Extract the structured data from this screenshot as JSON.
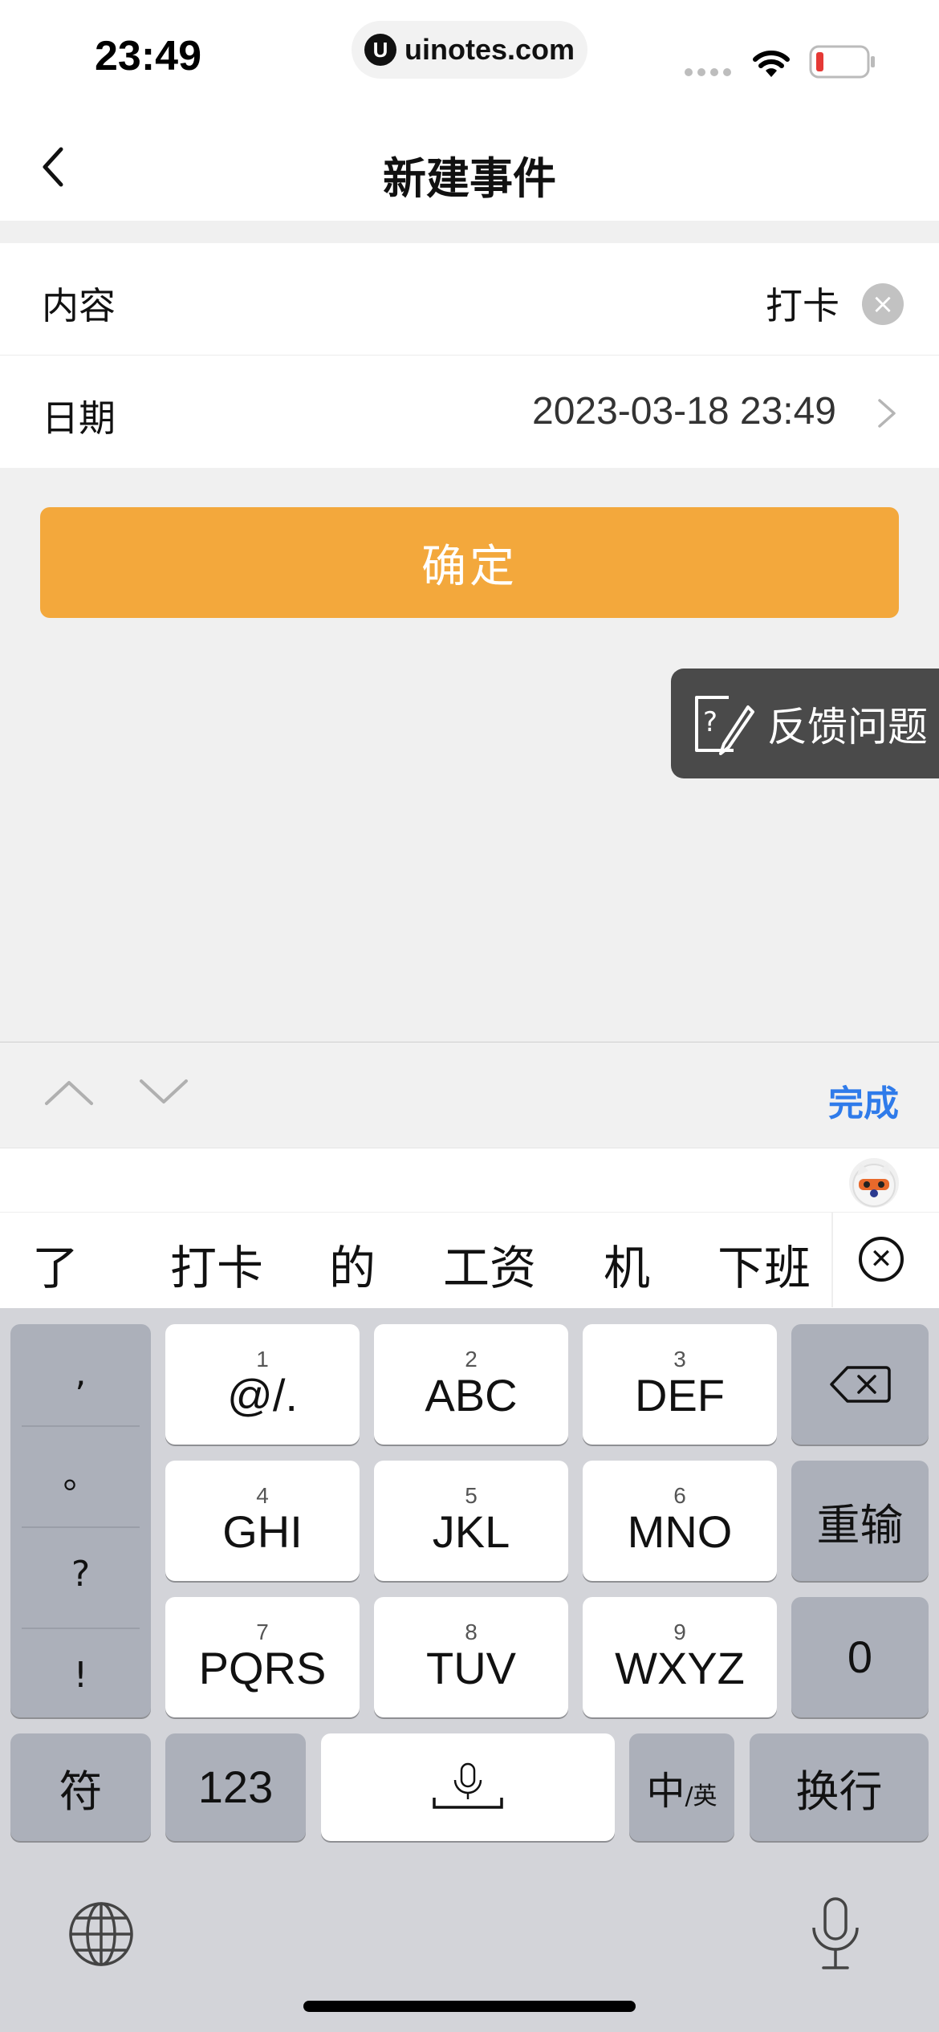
{
  "status_bar": {
    "time": "23:49",
    "url": "uinotes.com",
    "url_logo": "U"
  },
  "nav": {
    "title": "新建事件"
  },
  "form": {
    "content_label": "内容",
    "content_value": "打卡",
    "date_label": "日期",
    "date_value": "2023-03-18 23:49"
  },
  "confirm_label": "确定",
  "feedback_label": "反馈问题",
  "accessory": {
    "done_label": "完成"
  },
  "candidates": [
    "了",
    "打卡",
    "的",
    "工资",
    "机",
    "下班"
  ],
  "keyboard": {
    "punct": [
      ",",
      "。",
      "?",
      "!"
    ],
    "keys": [
      {
        "num": "1",
        "letters": "@/."
      },
      {
        "num": "2",
        "letters": "ABC"
      },
      {
        "num": "3",
        "letters": "DEF"
      },
      {
        "num": "4",
        "letters": "GHI"
      },
      {
        "num": "5",
        "letters": "JKL"
      },
      {
        "num": "6",
        "letters": "MNO"
      },
      {
        "num": "7",
        "letters": "PQRS"
      },
      {
        "num": "8",
        "letters": "TUV"
      },
      {
        "num": "9",
        "letters": "WXYZ"
      }
    ],
    "retype": "重输",
    "zero": "0",
    "symbols": "符",
    "numbers": "123",
    "lang_main": "中",
    "lang_sub": "/英",
    "newline": "换行"
  },
  "colors": {
    "accent": "#f3a83c",
    "done": "#2f7bea",
    "feedback_bg": "#4a4a4a"
  }
}
